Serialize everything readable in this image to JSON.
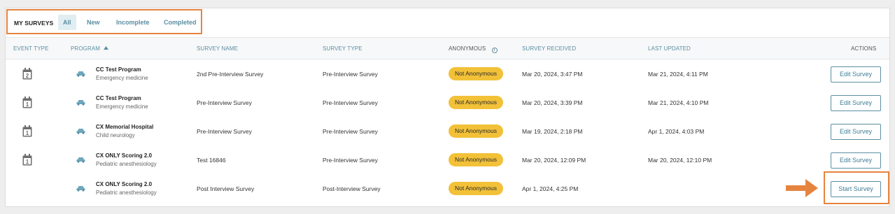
{
  "tabs": {
    "title": "MY SURVEYS",
    "items": [
      {
        "label": "All",
        "active": true
      },
      {
        "label": "New",
        "active": false
      },
      {
        "label": "Incomplete",
        "active": false
      },
      {
        "label": "Completed",
        "active": false
      }
    ]
  },
  "columns": {
    "event_type": "EVENT TYPE",
    "program": "PROGRAM",
    "program_sort_icon": "sort-ascending-icon",
    "survey_name": "SURVEY NAME",
    "survey_type": "SURVEY TYPE",
    "anonymous": "ANONYMOUS",
    "anonymous_icon": "info-icon",
    "received": "SURVEY RECEIVED",
    "updated": "LAST UPDATED",
    "actions": "ACTIONS"
  },
  "rows": [
    {
      "event_day": "2",
      "program": "CC Test Program",
      "specialty": "Emergency medicine",
      "survey_name": "2nd Pre-Interview Survey",
      "survey_type": "Pre-Interview Survey",
      "anonymous": "Not Anonymous",
      "received": "Mar 20, 2024, 3:47 PM",
      "updated": "Mar 21, 2024, 4:11 PM",
      "action": "Edit Survey"
    },
    {
      "event_day": "1",
      "program": "CC Test Program",
      "specialty": "Emergency medicine",
      "survey_name": "Pre-Interview Survey",
      "survey_type": "Pre-Interview Survey",
      "anonymous": "Not Anonymous",
      "received": "Mar 20, 2024, 3:39 PM",
      "updated": "Mar 21, 2024, 4:10 PM",
      "action": "Edit Survey"
    },
    {
      "event_day": "1",
      "program": "CX Memorial Hospital",
      "specialty": "Child neurology",
      "survey_name": "Pre-Interview Survey",
      "survey_type": "Pre-Interview Survey",
      "anonymous": "Not Anonymous",
      "received": "Mar 19, 2024, 2:18 PM",
      "updated": "Apr 1, 2024, 4:03 PM",
      "action": "Edit Survey"
    },
    {
      "event_day": "1",
      "program": "CX ONLY Scoring 2.0",
      "specialty": "Pediatric anesthesiology",
      "survey_name": "Test 16846",
      "survey_type": "Pre-Interview Survey",
      "anonymous": "Not Anonymous",
      "received": "Mar 20, 2024, 12:09 PM",
      "updated": "Mar 20, 2024, 12:10 PM",
      "action": "Edit Survey"
    },
    {
      "event_day": "",
      "program": "CX ONLY Scoring 2.0",
      "specialty": "Pediatric anesthesiology",
      "survey_name": "Post Interview Survey",
      "survey_type": "Post-Interview Survey",
      "anonymous": "Not Anonymous",
      "received": "Apr 1, 2024, 4:25 PM",
      "updated": "",
      "action": "Start Survey"
    }
  ],
  "icons": {
    "event": "calendar-icon",
    "program": "car-icon",
    "annotation": "arrow-right-icon"
  },
  "colors": {
    "accent": "#5b8ea3",
    "badge": "#f2c138",
    "highlight": "#e5843f"
  }
}
